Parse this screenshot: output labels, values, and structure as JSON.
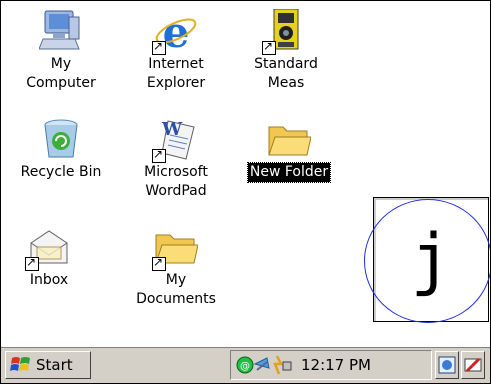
{
  "desktop": {
    "icons": [
      {
        "label": "My\nComputer",
        "icon": "my-computer-icon"
      },
      {
        "label": "Internet\nExplorer",
        "icon": "internet-explorer-icon"
      },
      {
        "label": "Standard\nMeas",
        "icon": "standard-meas-icon"
      },
      {
        "label": "Recycle Bin",
        "icon": "recycle-bin-icon"
      },
      {
        "label": "Microsoft\nWordPad",
        "icon": "wordpad-icon"
      },
      {
        "label": "New Folder",
        "icon": "folder-icon"
      },
      {
        "label": "Inbox",
        "icon": "inbox-icon"
      },
      {
        "label": "My\nDocuments",
        "icon": "my-documents-icon"
      }
    ]
  },
  "sip": {
    "character": "j"
  },
  "taskbar": {
    "start_label": "Start",
    "clock": "12:17 PM"
  },
  "colors": {
    "circle": "#2030e0",
    "taskbar": "#d4d0c8",
    "selection": "#000000"
  }
}
